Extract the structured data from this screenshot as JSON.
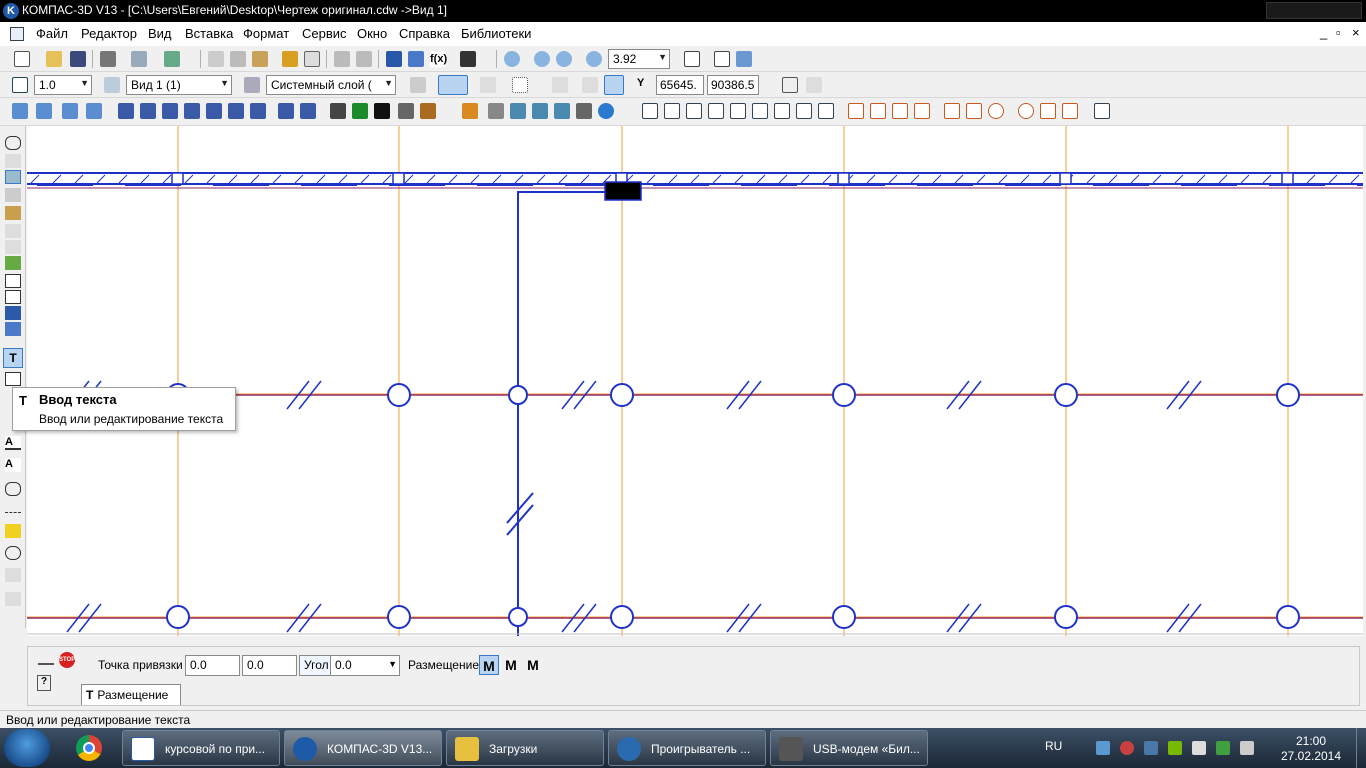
{
  "window": {
    "title": "КОМПАС-3D V13 - [C:\\Users\\Евгений\\Desktop\\Чертеж оригинал.cdw ->Вид 1]",
    "app_icon": "kompas-icon"
  },
  "menu": {
    "items": [
      "Файл",
      "Редактор",
      "Вид",
      "Вставка",
      "Формат",
      "Сервис",
      "Окно",
      "Справка",
      "Библиотеки"
    ],
    "controls": [
      "_",
      "▫",
      "×"
    ]
  },
  "toolbar1": {
    "zoom_value": "3.92",
    "icons": [
      "new-icon",
      "open-icon",
      "save-icon",
      "print-icon",
      "preview-icon",
      "cut-icon",
      "copy-icon",
      "paste-icon",
      "brush-icon",
      "undo-icon",
      "redo-icon",
      "manager-icon",
      "variables-icon",
      "fx-icon",
      "help-pointer-icon",
      "zoom-icon",
      "zoom-frame-icon",
      "zoom-in-icon",
      "zoom-scale-icon",
      "pan-icon",
      "refresh-icon"
    ]
  },
  "toolbar2": {
    "line_step": "1.0",
    "view": "Вид 1 (1)",
    "layer": "Системный слой (",
    "coord_label": "Y",
    "coord_x": "65645.",
    "coord_y": "90386.5"
  },
  "tooltip": {
    "title": "Ввод текста",
    "description": "Ввод или редактирование текста"
  },
  "properties": {
    "anchor_label": "Точка привязки",
    "anchor_x": "0.0",
    "anchor_y": "0.0",
    "angle_label": "Угол",
    "angle_value": "0.0",
    "placement_label": "Размещение",
    "tab_label": "Размещение",
    "stop_label": "STOP"
  },
  "status_text": "Ввод или редактирование текста",
  "taskbar": {
    "tasks": [
      {
        "label": "курсовой по при...",
        "icon": "word-icon"
      },
      {
        "label": "КОМПАС-3D V13...",
        "icon": "kompas-icon"
      },
      {
        "label": "Загрузки",
        "icon": "downloads-icon"
      },
      {
        "label": "Проигрыватель ...",
        "icon": "media-player-icon"
      },
      {
        "label": "USB-модем «Бил...",
        "icon": "usb-modem-icon"
      }
    ],
    "language": "RU",
    "time": "21:00",
    "date": "27.02.2014"
  },
  "colors": {
    "blue_line": "#1e32c8",
    "orange_axis": "#f0a030",
    "magenta_line": "#9a2a6a"
  }
}
